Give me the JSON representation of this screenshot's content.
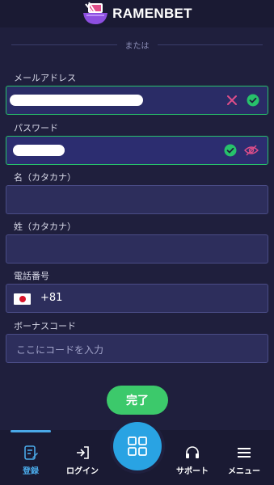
{
  "header": {
    "brand": "RAMENBET"
  },
  "divider": {
    "text": "または"
  },
  "form": {
    "email": {
      "label": "メールアドレス"
    },
    "password": {
      "label": "パスワード"
    },
    "first_name": {
      "label": "名（カタカナ）"
    },
    "last_name": {
      "label": "姓（カタカナ）"
    },
    "phone": {
      "label": "電話番号",
      "country_code": "+81"
    },
    "bonus": {
      "label": "ボーナスコード",
      "placeholder": "ここにコードを入力"
    },
    "submit_label": "完了"
  },
  "bottom_nav": {
    "register": "登録",
    "login": "ログイン",
    "support": "サポート",
    "menu": "メニュー"
  },
  "colors": {
    "accent_green": "#3cc96b",
    "accent_blue": "#29a3e3",
    "clear_icon": "#e04e8a"
  }
}
